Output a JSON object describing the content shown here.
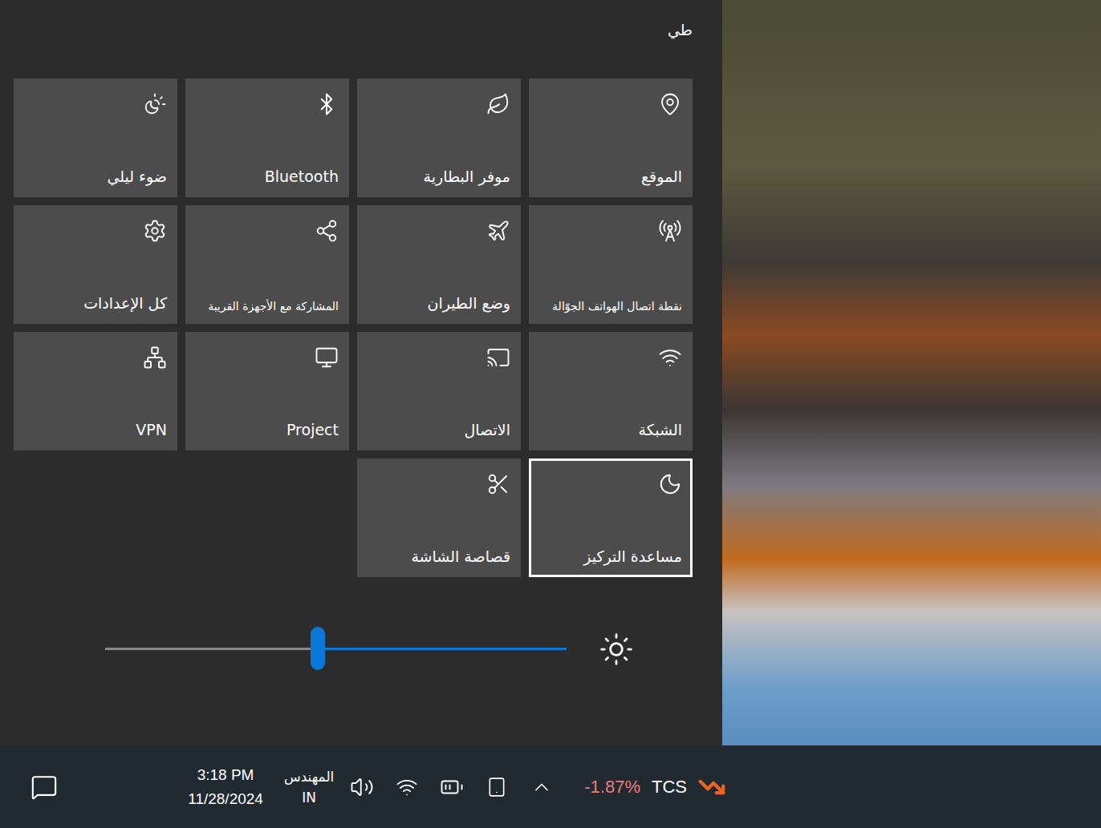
{
  "header": {
    "collapse_label": "طي"
  },
  "tiles": [
    {
      "label": "الموقع",
      "focused": false
    },
    {
      "label": "موفر البطارية",
      "focused": false
    },
    {
      "label": "Bluetooth",
      "focused": false
    },
    {
      "label": "ضوء ليلي",
      "focused": false
    },
    {
      "label": "نقطة اتصال الهواتف الجوّالة",
      "focused": false
    },
    {
      "label": "وضع الطيران",
      "focused": false
    },
    {
      "label": "المشاركة مع الأجهزة القريبة",
      "focused": false
    },
    {
      "label": "كل الإعدادات",
      "focused": false
    },
    {
      "label": "الشبكة",
      "focused": false
    },
    {
      "label": "الاتصال",
      "focused": false
    },
    {
      "label": "Project",
      "focused": false
    },
    {
      "label": "VPN",
      "focused": false
    },
    {
      "label": "مساعدة التركيز",
      "focused": true
    },
    {
      "label": "قصاصة الشاشة",
      "focused": false
    }
  ],
  "brightness": {
    "level": 0.54
  },
  "taskbar": {
    "stock": {
      "symbol": "TCS",
      "change": "-1.87%"
    },
    "language": {
      "top": "المهندس",
      "bottom": "IN"
    },
    "clock": {
      "time": "3:18 PM",
      "date": "11/28/2024"
    }
  }
}
